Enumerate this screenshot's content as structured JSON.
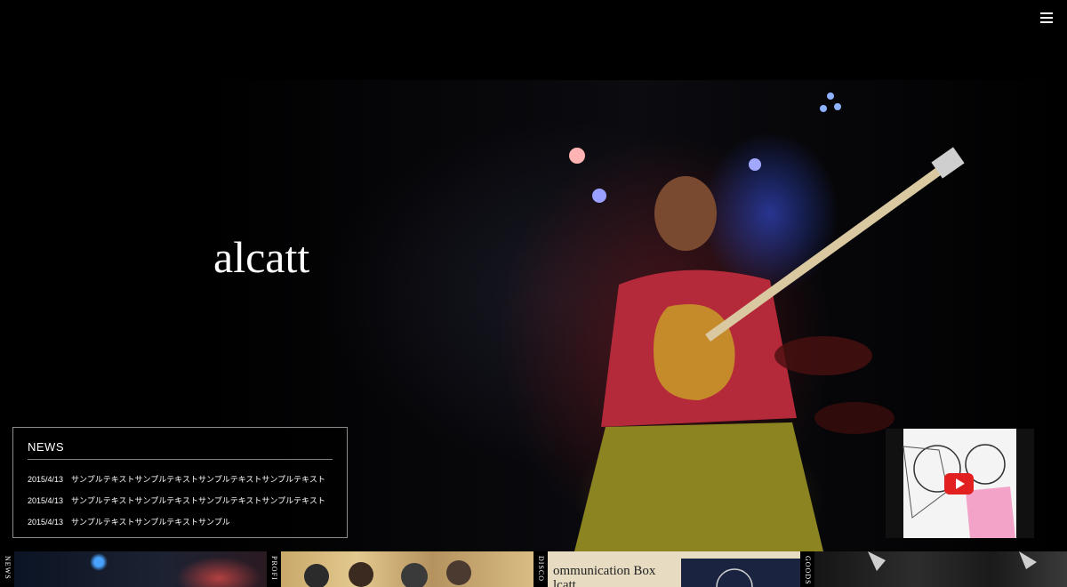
{
  "menu": {
    "icon": "hamburger-menu-icon"
  },
  "logo": {
    "text": "alcatt"
  },
  "news": {
    "title": "NEWS",
    "items": [
      {
        "date": "2015/4/13",
        "text": "サンプルテキストサンプルテキストサンプルテキストサンプルテキスト"
      },
      {
        "date": "2015/4/13",
        "text": "サンプルテキストサンプルテキストサンプルテキストサンプルテキスト"
      },
      {
        "date": "2015/4/13",
        "text": "サンプルテキストサンプルテキストサンプル"
      }
    ]
  },
  "video": {
    "icon": "youtube-play-icon"
  },
  "sections": [
    {
      "label": "NEWS"
    },
    {
      "label": "PROFI"
    },
    {
      "label": "DISCO"
    },
    {
      "label": "GOODS"
    }
  ],
  "disco_cover": {
    "line1": "ommunication Box",
    "line2": "lcatt"
  },
  "colors": {
    "background": "#000000",
    "accent": "#e32020"
  }
}
